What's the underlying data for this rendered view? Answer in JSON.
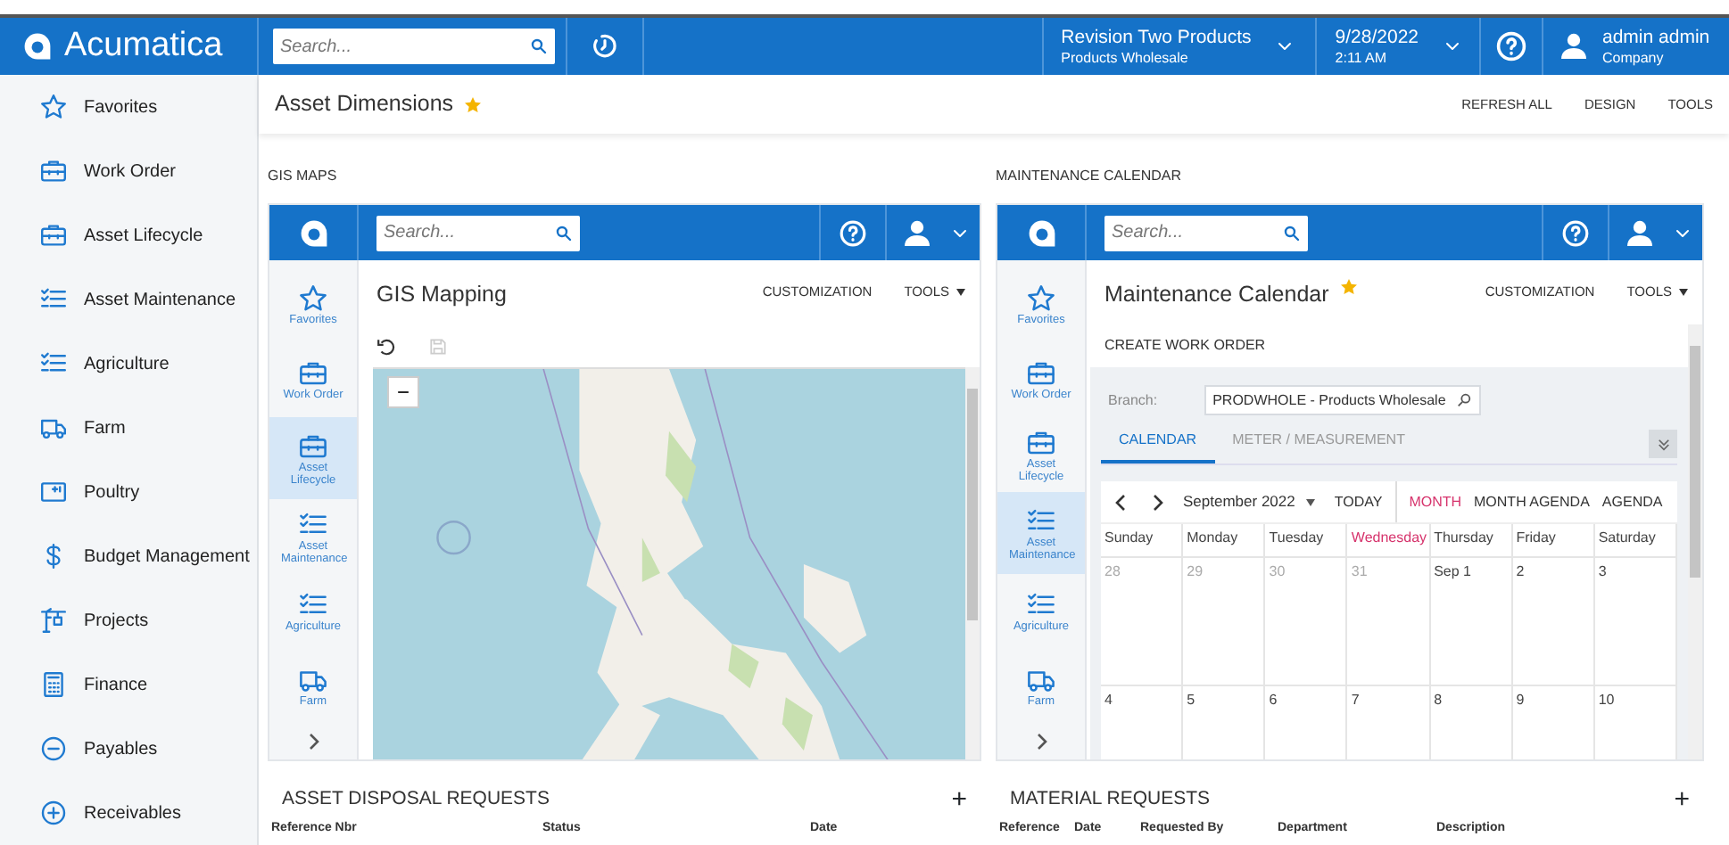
{
  "app": {
    "logo": "Acumatica",
    "search_placeholder": "Search...",
    "company": {
      "name": "Revision Two Products",
      "branch": "Products Wholesale"
    },
    "datetime": {
      "date": "9/28/2022",
      "time": "2:11 AM"
    },
    "user": {
      "name": "admin admin",
      "company": "Company"
    }
  },
  "sidebar": {
    "items": [
      {
        "label": "Favorites",
        "kind": "star"
      },
      {
        "label": "Work Order",
        "kind": "briefcase"
      },
      {
        "label": "Asset Lifecycle",
        "kind": "briefcase"
      },
      {
        "label": "Asset Maintenance",
        "kind": "checklist"
      },
      {
        "label": "Agriculture",
        "kind": "checklist"
      },
      {
        "label": "Farm",
        "kind": "truck"
      },
      {
        "label": "Poultry",
        "kind": "card"
      },
      {
        "label": "Budget Management",
        "kind": "dollar"
      },
      {
        "label": "Projects",
        "kind": "crane"
      },
      {
        "label": "Finance",
        "kind": "calculator"
      },
      {
        "label": "Payables",
        "kind": "minus"
      },
      {
        "label": "Receivables",
        "kind": "plus"
      }
    ]
  },
  "page": {
    "title": "Asset Dimensions",
    "favorite": true,
    "actions": [
      "REFRESH ALL",
      "DESIGN",
      "TOOLS"
    ]
  },
  "widgets": [
    {
      "caption": "GIS MAPS",
      "kind": "map",
      "search_placeholder": "Search...",
      "nav": [
        {
          "label": "Favorites",
          "kind": "star",
          "selected": false
        },
        {
          "label": "Work Order",
          "kind": "briefcase",
          "selected": false
        },
        {
          "label": "Asset Lifecycle",
          "kind": "briefcase",
          "selected": true
        },
        {
          "label": "Asset Maintenance",
          "kind": "checklist",
          "selected": false
        },
        {
          "label": "Agriculture",
          "kind": "checklist",
          "selected": false
        },
        {
          "label": "Farm",
          "kind": "truck",
          "selected": false
        }
      ],
      "title": "GIS Mapping",
      "favorite": false,
      "actions": [
        "CUSTOMIZATION",
        "TOOLS"
      ],
      "save_disabled": true,
      "zoom_out": "−"
    },
    {
      "caption": "MAINTENANCE CALENDAR",
      "kind": "calendar",
      "search_placeholder": "Search...",
      "nav": [
        {
          "label": "Favorites",
          "kind": "star",
          "selected": false
        },
        {
          "label": "Work Order",
          "kind": "briefcase",
          "selected": false
        },
        {
          "label": "Asset Lifecycle",
          "kind": "briefcase",
          "selected": false
        },
        {
          "label": "Asset Maintenance",
          "kind": "checklist",
          "selected": true
        },
        {
          "label": "Agriculture",
          "kind": "checklist",
          "selected": false
        },
        {
          "label": "Farm",
          "kind": "truck",
          "selected": false
        }
      ],
      "title": "Maintenance Calendar",
      "favorite": true,
      "actions": [
        "CUSTOMIZATION",
        "TOOLS"
      ],
      "toolbar": [
        "CREATE WORK ORDER"
      ],
      "branch": {
        "label": "Branch:",
        "value": "PRODWHOLE - Products Wholesale"
      },
      "tabs": [
        {
          "label": "CALENDAR",
          "selected": true
        },
        {
          "label": "METER / MEASUREMENT",
          "selected": false
        }
      ],
      "month": "September 2022",
      "today": "TODAY",
      "views": [
        {
          "label": "MONTH",
          "selected": true
        },
        {
          "label": "MONTH AGENDA",
          "selected": false
        },
        {
          "label": "AGENDA",
          "selected": false
        }
      ],
      "weekdays": [
        {
          "label": "Sunday",
          "today": false
        },
        {
          "label": "Monday",
          "today": false
        },
        {
          "label": "Tuesday",
          "today": false
        },
        {
          "label": "Wednesday",
          "today": true
        },
        {
          "label": "Thursday",
          "today": false
        },
        {
          "label": "Friday",
          "today": false
        },
        {
          "label": "Saturday",
          "today": false
        }
      ],
      "weeks": [
        [
          {
            "day": "28",
            "outside": true
          },
          {
            "day": "29",
            "outside": true
          },
          {
            "day": "30",
            "outside": true
          },
          {
            "day": "31",
            "outside": true
          },
          {
            "day": "Sep 1",
            "outside": false
          },
          {
            "day": "2",
            "outside": false
          },
          {
            "day": "3",
            "outside": false
          }
        ],
        [
          {
            "day": "4",
            "outside": false
          },
          {
            "day": "5",
            "outside": false
          },
          {
            "day": "6",
            "outside": false
          },
          {
            "day": "7",
            "outside": false
          },
          {
            "day": "8",
            "outside": false
          },
          {
            "day": "9",
            "outside": false
          },
          {
            "day": "10",
            "outside": false
          }
        ]
      ]
    }
  ],
  "grids": [
    {
      "title": "ASSET DISPOSAL REQUESTS",
      "add": "+",
      "columns": [
        "Reference Nbr",
        "Status",
        "Date"
      ]
    },
    {
      "title": "MATERIAL REQUESTS",
      "add": "+",
      "columns": [
        "Reference",
        "Date",
        "Requested By",
        "Department",
        "Description"
      ]
    }
  ]
}
